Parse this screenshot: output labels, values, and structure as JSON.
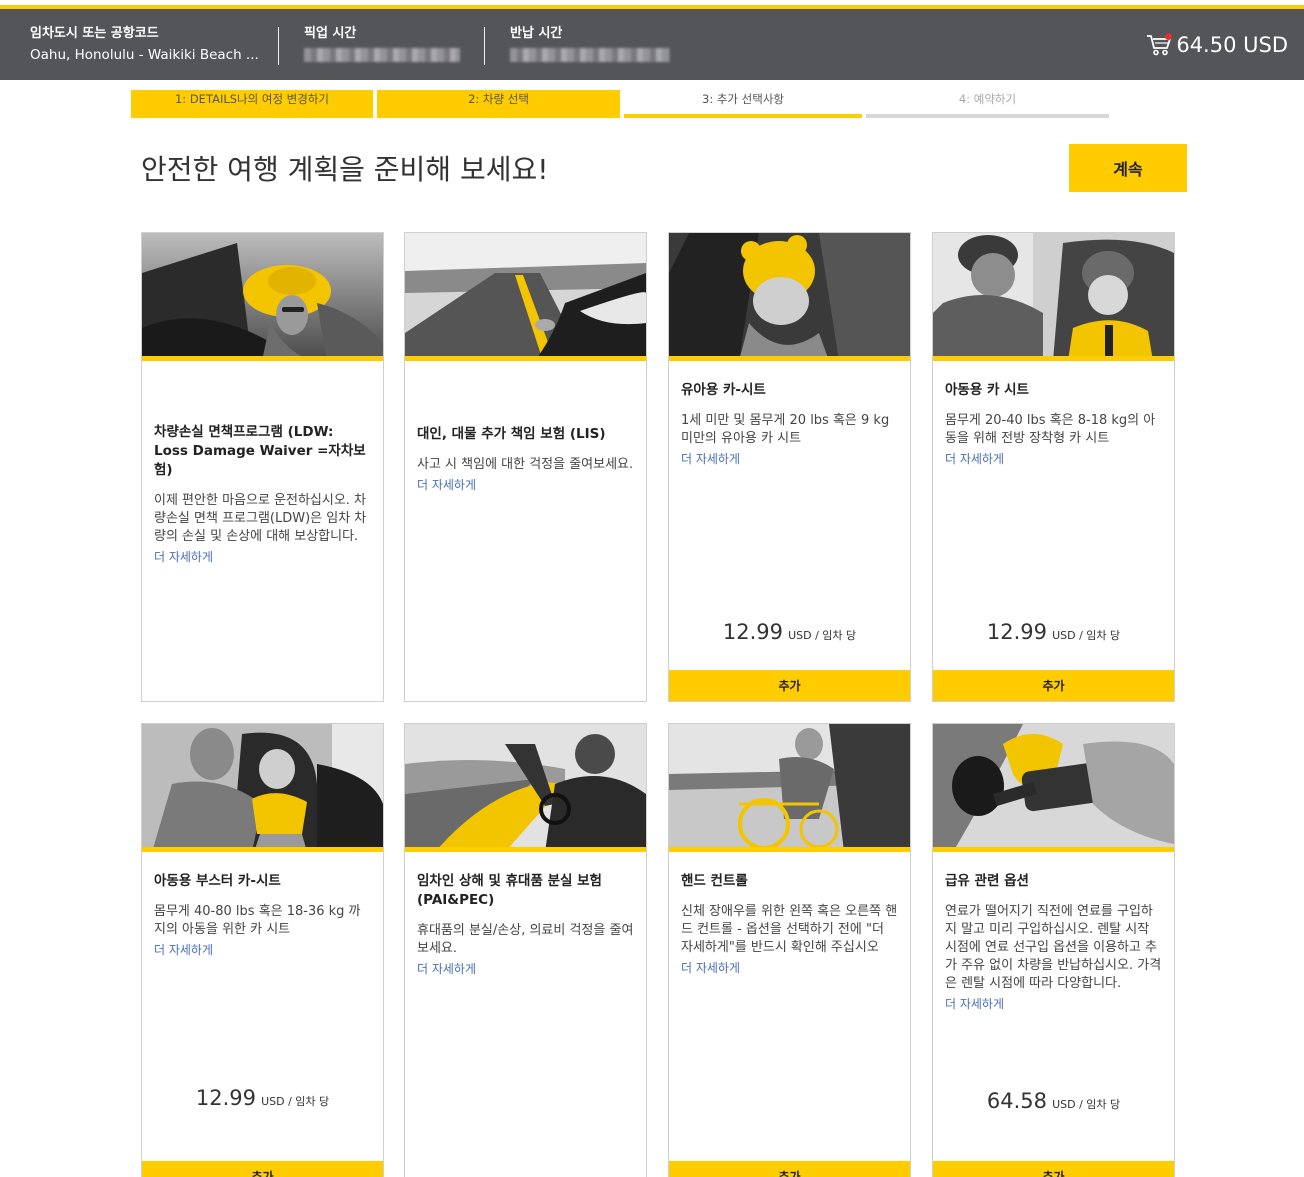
{
  "header": {
    "location_label": "임차도시 또는 공항코드",
    "location_value": "Oahu, Honolulu - Waikiki Beach ...",
    "pickup_label": "픽업 시간",
    "return_label": "반납 시간",
    "cart_total": "64.50 USD"
  },
  "steps": [
    {
      "label": "1:  DETAILS나의 여정 변경하기"
    },
    {
      "label": "2:  차량 선택"
    },
    {
      "label": "3:  추가 선택사항"
    },
    {
      "label": "4:  예약하기"
    }
  ],
  "page": {
    "title": "안전한 여행 계획을 준비해 보세요!",
    "continue_label": "계속"
  },
  "cards": [
    {
      "title": "차량손실 면책프로그램 (LDW: Loss Damage Waiver =자차보험)",
      "desc": "이제 편안한 마음으로 운전하십시오. 차량손실 면책 프로그램(LDW)은 임차 차량의 손실 및 손상에 대해 보상합니다.",
      "more": "더 자세하게",
      "image": "woman-driving-yellow-hat"
    },
    {
      "title": "대인, 대물 추가 책임 보험 (LIS)",
      "desc": "사고 시 책임에 대한 걱정을 줄여보세요.",
      "more": "더 자세하게",
      "image": "open-road-yellow-line"
    },
    {
      "title": "유아용 카-시트",
      "desc": "1세 미만 및 몸무게 20 lbs 혹은 9 kg 미만의 유아용 카 시트",
      "more": "더 자세하게",
      "price": "12.99",
      "unit": "USD / 임차 당",
      "add": "추가",
      "image": "infant-car-seat"
    },
    {
      "title": "아동용 카 시트",
      "desc": "몸무게 20-40 lbs 혹은 8-18 kg의 아동을 위해 전방 장착형 카 시트",
      "more": "더 자세하게",
      "price": "12.99",
      "unit": "USD / 임차 당",
      "add": "추가",
      "image": "child-car-seat"
    },
    {
      "title": "아동용 부스터 카-시트",
      "desc": "몸무게 40-80 lbs 혹은 18-36 kg 까지의 아동을 위한 카 시트",
      "more": "더 자세하게",
      "price": "12.99",
      "unit": "USD / 임차 당",
      "add": "추가",
      "image": "booster-seat"
    },
    {
      "title": "임차인 상해 및 휴대품 분실 보험 (PAI&PEC)",
      "desc": "휴대품의 분실/손상, 의료비 걱정을 줄여보세요.",
      "more": "더 자세하게",
      "image": "convertible-driver"
    },
    {
      "title": "핸드 컨트롤",
      "desc": "신체 장애우를 위한 왼쪽 혹은 오른쪽 핸드 컨트롤 - 옵션을 선택하기 전에 \"더 자세하게\"를 반드시 확인해 주십시오",
      "more": "더 자세하게",
      "add": "추가",
      "image": "wheelchair-user"
    },
    {
      "title": "급유 관련 옵션",
      "desc": "연료가 떨어지기 직전에 연료를 구입하지 말고 미리 구입하십시오. 렌탈 시작 시점에 연료 선구입 옵션을 이용하고 추가 주유 없이 차량을 반납하십시오. 가격은 렌탈 시점에 따라 다양합니다.",
      "more": "더 자세하게",
      "price": "64.58",
      "unit": "USD / 임차 당",
      "add": "추가",
      "image": "fuel-nozzle"
    }
  ],
  "colors": {
    "brand_yellow": "#ffcc00",
    "header_gray": "#545559",
    "link_blue": "#4a70b8"
  }
}
